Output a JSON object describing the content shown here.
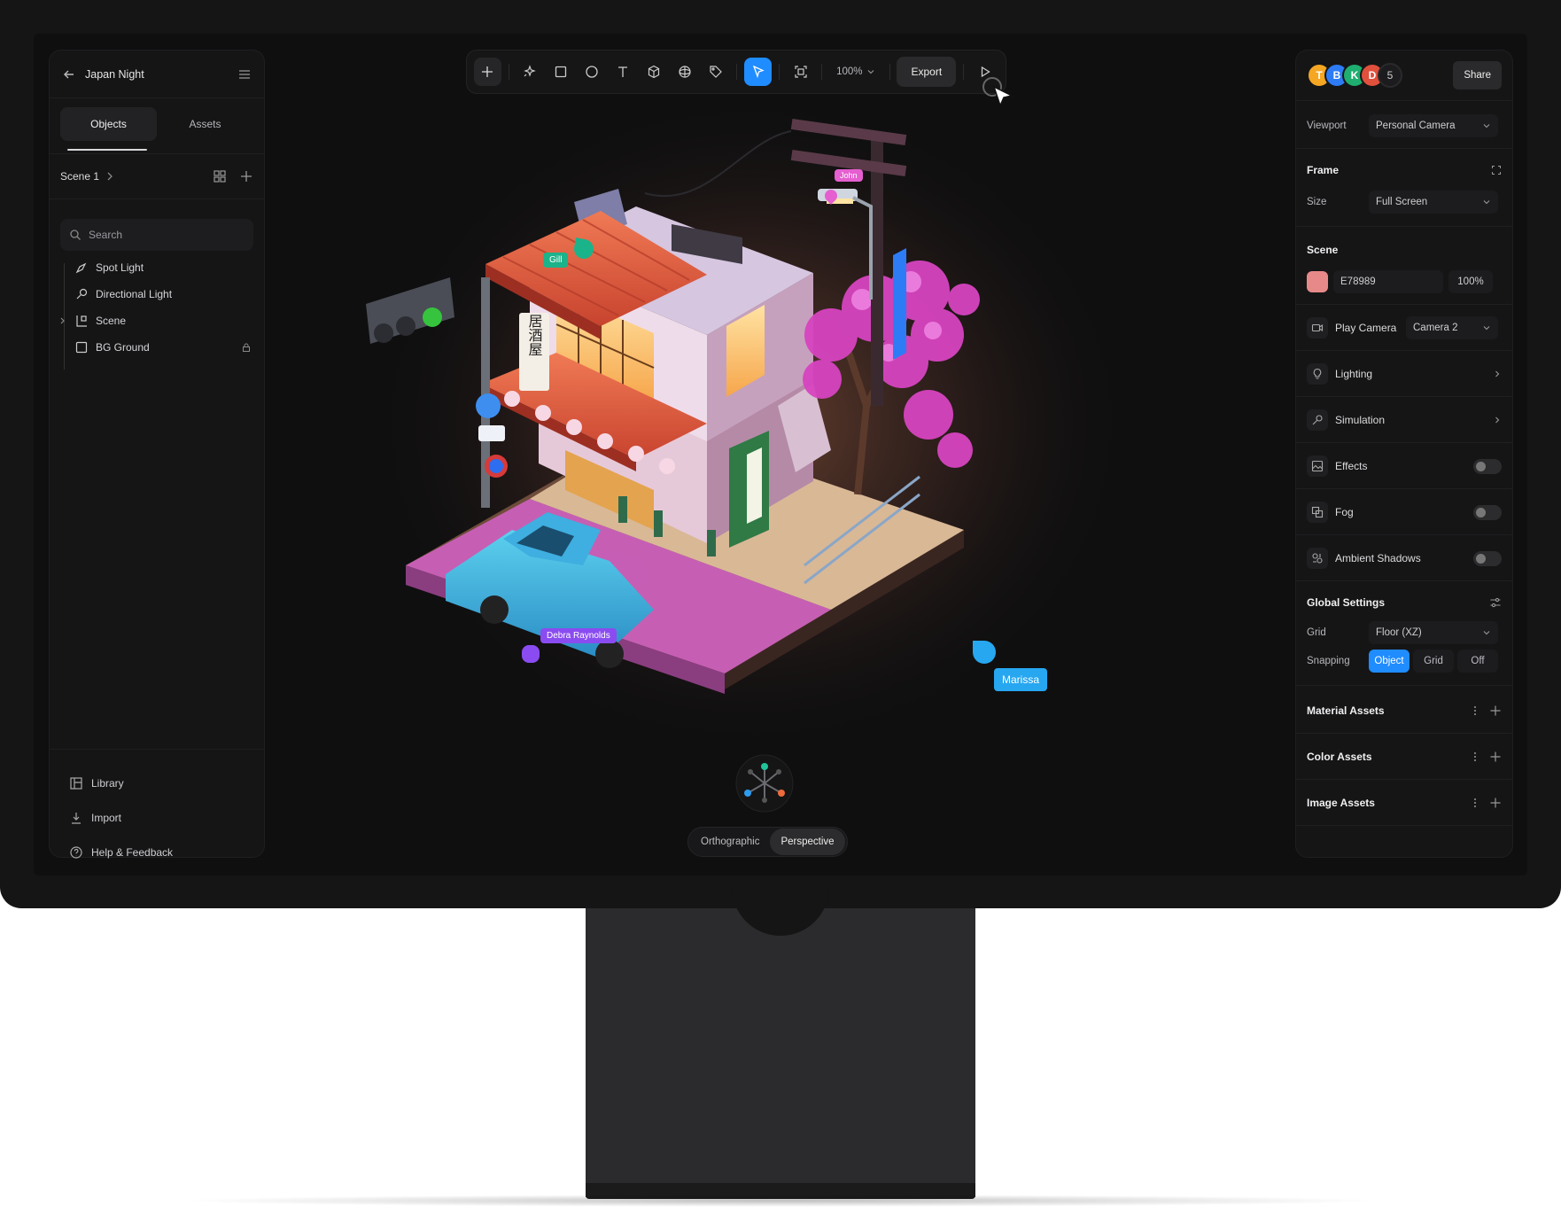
{
  "project": {
    "title": "Japan Night"
  },
  "left_panel": {
    "tabs": [
      {
        "label": "Objects"
      },
      {
        "label": "Assets"
      }
    ],
    "scene_label": "Scene 1",
    "search_placeholder": "Search",
    "tree": [
      {
        "label": "Spot Light",
        "icon": "spotlight-icon"
      },
      {
        "label": "Directional Light",
        "icon": "directional-light-icon"
      },
      {
        "label": "Scene",
        "icon": "scene-icon"
      },
      {
        "label": "BG Ground",
        "icon": "square-icon",
        "locked": true
      }
    ],
    "footer": [
      {
        "label": "Library",
        "icon": "library-icon"
      },
      {
        "label": "Import",
        "icon": "import-icon"
      },
      {
        "label": "Help & Feedback",
        "icon": "help-icon"
      }
    ]
  },
  "toolbar": {
    "tools": [
      "add-icon",
      "ai-sparkle-icon",
      "rectangle-icon",
      "ellipse-icon",
      "text-icon",
      "cube-icon",
      "sphere-icon",
      "tag-icon",
      "select-cursor-icon",
      "frame-icon"
    ],
    "zoom": "100%",
    "export_label": "Export",
    "play": "play-icon"
  },
  "right_panel": {
    "collaborators": [
      {
        "initial": "T",
        "color": "#f5a623"
      },
      {
        "initial": "B",
        "color": "#2d7cf6"
      },
      {
        "initial": "K",
        "color": "#1fae6f"
      },
      {
        "initial": "D",
        "color": "#e0503c"
      }
    ],
    "collaborator_count": "5",
    "share_label": "Share",
    "viewport_label": "Viewport",
    "viewport_value": "Personal Camera",
    "frame_heading": "Frame",
    "size_label": "Size",
    "size_value": "Full Screen",
    "scene_heading": "Scene",
    "scene_color": "E78989",
    "scene_color_hex": "#e78989",
    "scene_opacity": "100%",
    "play_camera_label": "Play Camera",
    "play_camera_value": "Camera 2",
    "lighting_label": "Lighting",
    "simulation_label": "Simulation",
    "effects_label": "Effects",
    "fog_label": "Fog",
    "ambient_label": "Ambient Shadows",
    "global_heading": "Global Settings",
    "grid_label": "Grid",
    "grid_value": "Floor (XZ)",
    "snapping_label": "Snapping",
    "snapping_options": [
      "Object",
      "Grid",
      "Off"
    ],
    "snapping_selected": "Object",
    "material_assets": "Material Assets",
    "color_assets": "Color Assets",
    "image_assets": "Image Assets"
  },
  "viewport": {
    "cursors": [
      {
        "name": "John",
        "color": "#e55fd0"
      },
      {
        "name": "Gill",
        "color": "#1bb38a"
      },
      {
        "name": "Debra Raynolds",
        "color": "#8a4cf0"
      },
      {
        "name": "Marissa",
        "color": "#27a7f0"
      }
    ],
    "sign_text": "居酒屋",
    "view_modes": [
      "Orthographic",
      "Perspective"
    ],
    "view_selected": "Perspective"
  }
}
